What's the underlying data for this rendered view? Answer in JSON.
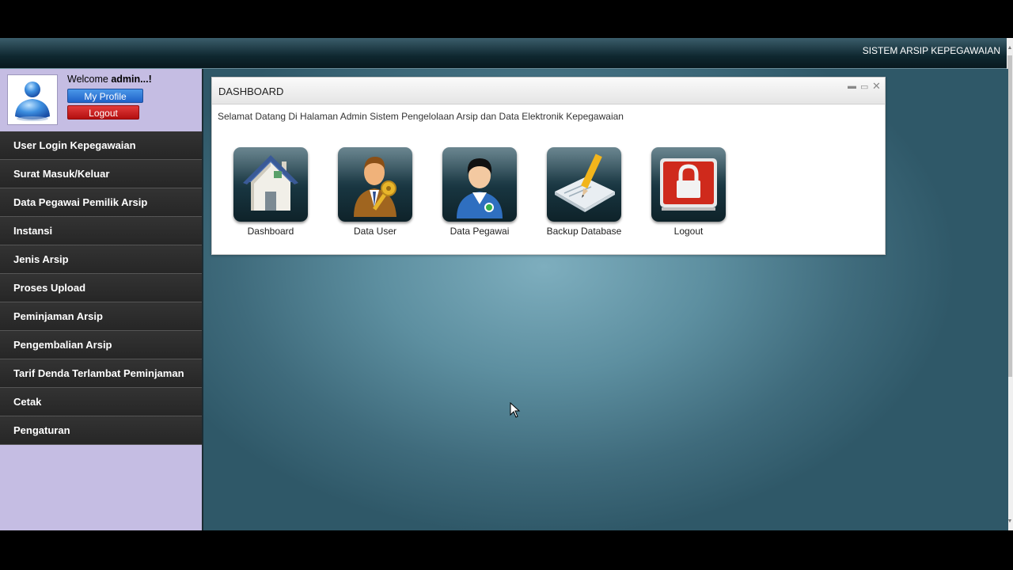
{
  "app": {
    "title": "SISTEM ARSIP KEPEGAWAIAN"
  },
  "user": {
    "welcome_prefix": "Welcome ",
    "welcome_name": "admin...!",
    "profile_label": "My Profile",
    "logout_label": "Logout",
    "avatar_icon": "user-avatar-icon"
  },
  "sidebar": {
    "items": [
      {
        "label": "User Login Kepegawaian"
      },
      {
        "label": "Surat Masuk/Keluar"
      },
      {
        "label": "Data Pegawai Pemilik Arsip"
      },
      {
        "label": "Instansi"
      },
      {
        "label": "Jenis Arsip"
      },
      {
        "label": "Proses Upload"
      },
      {
        "label": "Peminjaman Arsip"
      },
      {
        "label": "Pengembalian Arsip"
      },
      {
        "label": "Tarif Denda Terlambat Peminjaman"
      },
      {
        "label": "Cetak"
      },
      {
        "label": "Pengaturan"
      }
    ]
  },
  "panel": {
    "title": "DASHBOARD",
    "message": "Selamat Datang Di Halaman Admin Sistem Pengelolaan Arsip dan Data Elektronik Kepegawaian",
    "tiles": [
      {
        "label": "Dashboard",
        "icon": "house-icon"
      },
      {
        "label": "Data User",
        "icon": "user-key-icon"
      },
      {
        "label": "Data Pegawai",
        "icon": "employee-icon"
      },
      {
        "label": "Backup Database",
        "icon": "pencil-note-icon"
      },
      {
        "label": "Logout",
        "icon": "lock-icon"
      }
    ]
  },
  "colors": {
    "sidebar_bg": "#c5bde3",
    "menu_bg": "#2b2b2b",
    "profile_button": "#2a72d6",
    "logout_button": "#cc1f1f"
  }
}
